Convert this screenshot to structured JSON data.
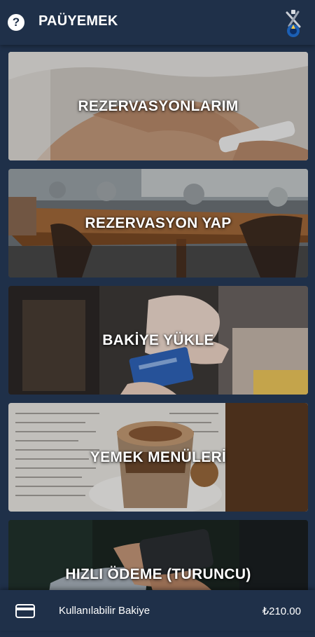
{
  "header": {
    "help_icon": "question-circle-icon",
    "help_glyph": "?",
    "title": "PAÜYEMEK",
    "logo": "pau-logo"
  },
  "menu": [
    {
      "label": "REZERVASYONLARIM",
      "image": "hands-with-phone-photo"
    },
    {
      "label": "REZERVASYON YAP",
      "image": "cafe-table-photo"
    },
    {
      "label": "BAKİYE YÜKLE",
      "image": "card-payment-photo"
    },
    {
      "label": "YEMEK MENÜLERİ",
      "image": "coffee-menu-photo"
    },
    {
      "label": "HIZLI ÖDEME (TURUNCU)",
      "image": "pos-terminal-photo"
    }
  ],
  "footer": {
    "card_icon": "credit-card-icon",
    "balance_label": "Kullanılabilir Bakiye",
    "balance_value": "₺210.00"
  },
  "colors": {
    "background": "#1f3049",
    "text": "#ffffff"
  }
}
